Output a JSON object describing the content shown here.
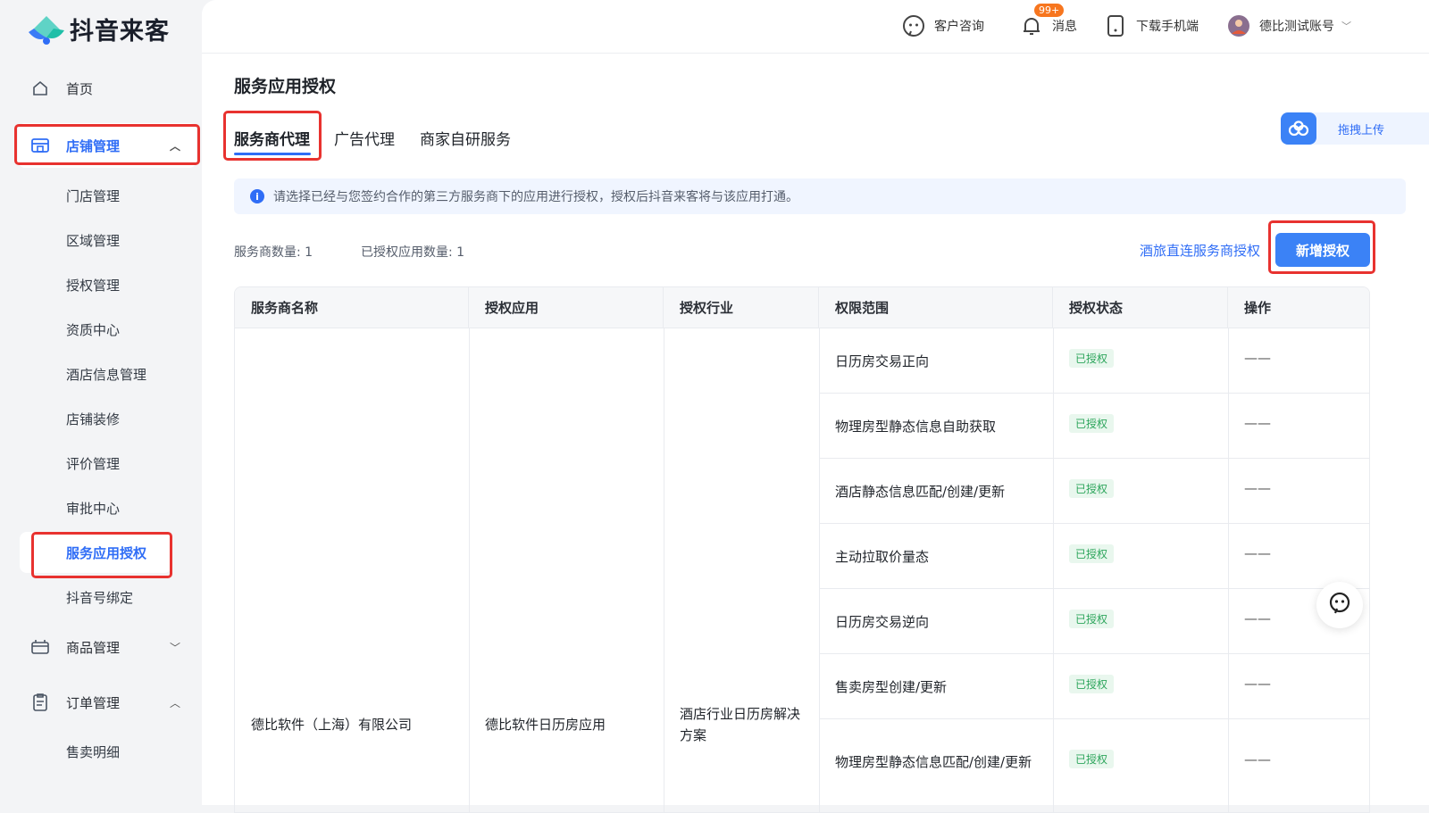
{
  "brand": {
    "name": "抖音来客"
  },
  "topbar": {
    "consult": "客户咨询",
    "messages": "消息",
    "messages_badge": "99+",
    "download": "下载手机端",
    "account": "德比测试账号"
  },
  "sidebar": {
    "home": "首页",
    "store_mgmt": "店铺管理",
    "store_sub": [
      "门店管理",
      "区域管理",
      "授权管理",
      "资质中心",
      "酒店信息管理",
      "店铺装修",
      "评价管理",
      "审批中心",
      "服务应用授权",
      "抖音号绑定"
    ],
    "goods_mgmt": "商品管理",
    "order_mgmt": "订单管理",
    "order_sub": [
      "售卖明细"
    ]
  },
  "page": {
    "title": "服务应用授权",
    "tabs": [
      "服务商代理",
      "广告代理",
      "商家自研服务"
    ],
    "upload": "拖拽上传",
    "info": "请选择已经与您签约合作的第三方服务商下的应用进行授权，授权后抖音来客将与该应用打通。",
    "stat_providers": "服务商数量: 1",
    "stat_apps": "已授权应用数量: 1",
    "link_direct": "酒旅直连服务商授权",
    "btn_add": "新增授权"
  },
  "table": {
    "headers": [
      "服务商名称",
      "授权应用",
      "授权行业",
      "权限范围",
      "授权状态",
      "操作"
    ],
    "provider": "德比软件（上海）有限公司",
    "app": "德比软件日历房应用",
    "industry": "酒店行业日历房解决方案",
    "rows": [
      {
        "scope": "日历房交易正向",
        "status": "已授权",
        "op": "——"
      },
      {
        "scope": "物理房型静态信息自助获取",
        "status": "已授权",
        "op": "——"
      },
      {
        "scope": "酒店静态信息匹配/创建/更新",
        "status": "已授权",
        "op": "——"
      },
      {
        "scope": "主动拉取价量态",
        "status": "已授权",
        "op": "——"
      },
      {
        "scope": "日历房交易逆向",
        "status": "已授权",
        "op": "——"
      },
      {
        "scope": "售卖房型创建/更新",
        "status": "已授权",
        "op": "——"
      },
      {
        "scope": "物理房型静态信息匹配/创建/更新",
        "status": "已授权",
        "op": "——"
      }
    ]
  },
  "colors": {
    "accent": "#2f6df6",
    "primary_btn": "#3b82f6",
    "highlight": "#e8322f",
    "status_green": "#2ca55b"
  }
}
